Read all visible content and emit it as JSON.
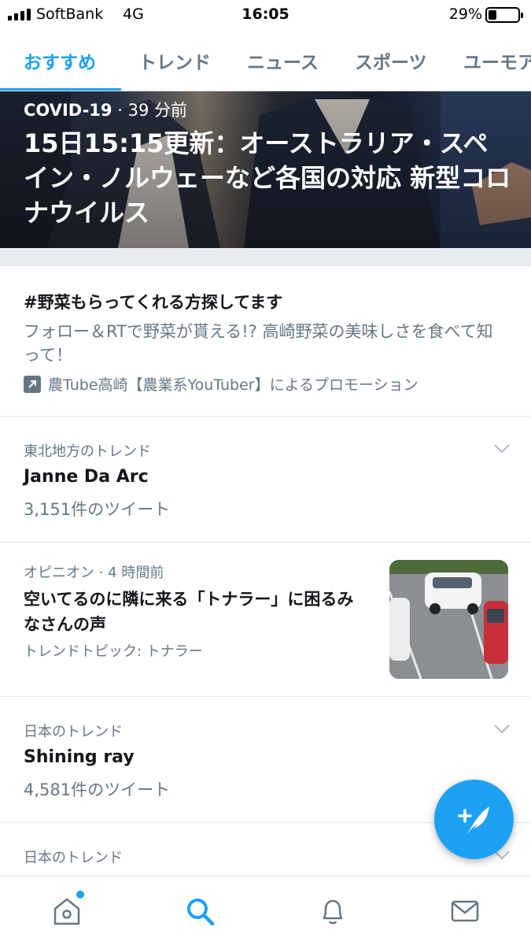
{
  "status_bar": {
    "carrier": "SoftBank",
    "network": "4G",
    "time": "16:05",
    "battery_percent": "29%",
    "battery_level": 0.29
  },
  "tabs": [
    {
      "label": "おすすめ",
      "active": true
    },
    {
      "label": "トレンド",
      "active": false
    },
    {
      "label": "ニュース",
      "active": false
    },
    {
      "label": "スポーツ",
      "active": false
    },
    {
      "label": "ユーモア",
      "active": false
    }
  ],
  "hero": {
    "category": "COVID-19",
    "separator": "·",
    "time_ago": "39 分前",
    "title": "15日15:15更新：オーストラリア・スペイン・ノルウェーなど各国の対応 新型コロナウイルス"
  },
  "promoted": {
    "title": "#野菜もらってくれる方探してます",
    "description": "フォロー＆RTで野菜が貰える!? 高崎野菜の美味しさを食べて知って！",
    "promoted_by": "農Tube高崎【農業系YouTuber】によるプロモーション"
  },
  "trends": [
    {
      "context": "東北地方のトレンド",
      "name": "Janne Da Arc",
      "count": "3,151件のツイート"
    },
    {
      "context": "日本のトレンド",
      "name": "Shining ray",
      "count": "4,581件のツイート"
    },
    {
      "context": "日本のトレンド",
      "name": "",
      "count": ""
    }
  ],
  "news": {
    "context": "オピニオン · 4 時間前",
    "title": "空いてるのに隣に来る「トナラー」に困るみなさんの声",
    "topic": "トレンドトピック: トナラー"
  },
  "colors": {
    "accent": "#1da1f2",
    "secondary_text": "#657786",
    "primary_text": "#14171a",
    "divider": "#e1e8ed"
  },
  "icons": {
    "fab": "compose-tweet-icon",
    "nav": [
      "home-icon",
      "search-icon",
      "notifications-icon",
      "messages-icon"
    ]
  }
}
